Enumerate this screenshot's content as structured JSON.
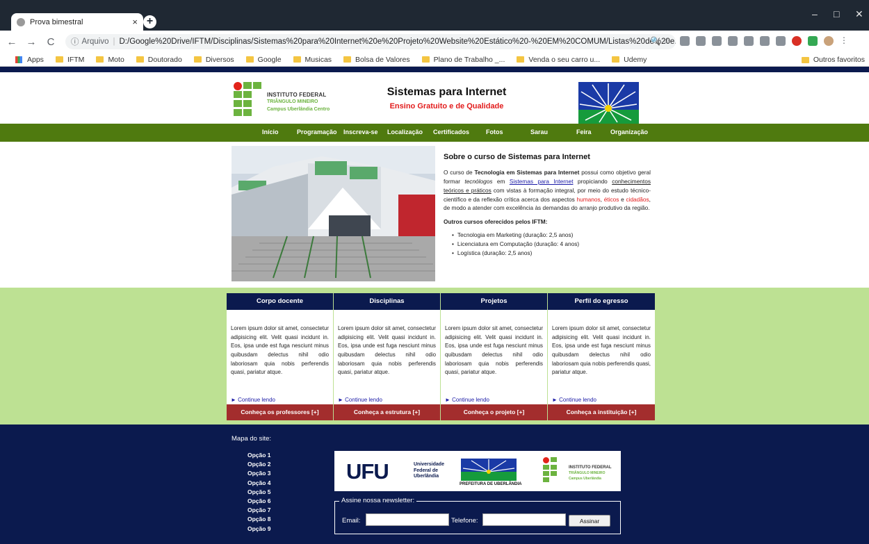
{
  "browser": {
    "tab_title": "Prova bimestral",
    "tab_close": "×",
    "new_tab": "+",
    "nav": {
      "back": "←",
      "forward": "→",
      "reload": "C"
    },
    "address": {
      "info_icon": "ⓘ",
      "scheme": "Arquivo",
      "url": "D:/Google%20Drive/IFTM/Disciplinas/Sistemas%20para%20Internet%20e%20Projeto%20Website%20Estático%20-%20EM%20COMUM/Listas%20de%20e...",
      "zoom_icon": "🔍",
      "star_icon": "☆"
    },
    "window_controls": {
      "minimize": "–",
      "maximize": "□",
      "close": "✕"
    },
    "bookmarks": [
      "Apps",
      "IFTM",
      "Moto",
      "Doutorado",
      "Diversos",
      "Google",
      "Musicas",
      "Bolsa de Valores",
      "Plano de Trabalho _...",
      "Venda o seu carro u...",
      "Udemy"
    ],
    "bookmarks_right": "Outros favoritos"
  },
  "header": {
    "logo_line1": "INSTITUTO FEDERAL",
    "logo_line2": "TRIÂNGULO MINEIRO",
    "logo_line3": "Campus Uberlândia Centro",
    "title": "Sistemas para Internet",
    "subtitle": "Ensino Gratuito e de Qualidade"
  },
  "nav": [
    "Início",
    "Programação",
    "Inscreva-se",
    "Localização",
    "Certificados",
    "Fotos",
    "Sarau",
    "Feira",
    "Organização"
  ],
  "about": {
    "heading": "Sobre o curso de Sistemas para Internet",
    "p_part1": "O curso de ",
    "p_bold": "Tecnologia em Sistemas para Internet",
    "p_part2": " possui como objetivo geral formar ",
    "p_italic": "tecnólogos",
    "p_part3": " em ",
    "p_link": "Sistemas para Internet",
    "p_part4": " propiciando ",
    "p_underline": "conhecimentos teóricos e práticos",
    "p_part5": " com vistas à formação integral, por meio do estudo técnico-científico e da reflexão crítica acerca dos aspectos ",
    "p_red1": "humanos",
    "p_comma": ", ",
    "p_red2": "éticos",
    "p_e": " e ",
    "p_red3": "cidadãos",
    "p_part6": ", de modo a atender com excelência às demandas do arranjo produtivo da região.",
    "other_heading": "Outros cursos oferecidos pelos IFTM:",
    "courses": [
      "Tecnologia em Marketing (duração: 2,5 anos)",
      "Licenciatura em Computação (duração: 4 anos)",
      "Logística (duração: 2,5 anos)"
    ]
  },
  "cards": [
    {
      "title": "Corpo docente",
      "text": "Lorem ipsum dolor sit amet, consectetur adipisicing elit. Velit quasi incidunt in. Eos, ipsa unde est fuga nesciunt minus quibusdam delectus nihil odio laboriosam quia nobis perferendis quasi, pariatur atque.",
      "more": "► Continue lendo",
      "foot": "Conheça os professores [+]"
    },
    {
      "title": "Disciplinas",
      "text": "Lorem ipsum dolor sit amet, consectetur adipisicing elit. Velit quasi incidunt in. Eos, ipsa unde est fuga nesciunt minus quibusdam delectus nihil odio laboriosam quia nobis perferendis quasi, pariatur atque.",
      "more": "► Continue lendo",
      "foot": "Conheça a estrutura [+]"
    },
    {
      "title": "Projetos",
      "text": "Lorem ipsum dolor sit amet, consectetur adipisicing elit. Velit quasi incidunt in. Eos, ipsa unde est fuga nesciunt minus quibusdam delectus nihil odio laboriosam quia nobis perferendis quasi, pariatur atque.",
      "more": "► Continue lendo",
      "foot": "Conheça o projeto [+]"
    },
    {
      "title": "Perfil do egresso",
      "text": "Lorem ipsum dolor sit amet, consectetur adipisicing elit. Velit quasi incidunt in. Eos, ipsa unde est fuga nesciunt minus quibusdam delectus nihil odio laboriosam quia nobis perferendis quasi, pariatur atque.",
      "more": "► Continue lendo",
      "foot": "Conheça a instituição [+]"
    }
  ],
  "footer": {
    "map_title": "Mapa do site:",
    "map_items": [
      "Opção 1",
      "Opção 2",
      "Opção 3",
      "Opção 4",
      "Opção 5",
      "Opção 6",
      "Opção 7",
      "Opção 8",
      "Opção 9"
    ],
    "ufu_big": "UFU",
    "ufu_small1": "Universidade",
    "ufu_small2": "Federal de",
    "ufu_small3": "Uberlândia",
    "pmu": "PREFEITURA DE UBERLÂNDIA",
    "ifes_t1": "INSTITUTO FEDERAL",
    "ifes_t2": "TRIÂNGULO MINEIRO",
    "ifes_t3": "Campus Uberlândia",
    "newsletter_legend": "Assine nossa newsletter:",
    "email_label": "Email:",
    "phone_label": "Telefone:",
    "submit": "Assinar"
  },
  "colors": {
    "dark_navy": "#0b1a4e",
    "nav_green": "#4f7a0f",
    "band_green": "#bde193",
    "card_red": "#a32d2d",
    "brand_green": "#6cb33f",
    "brand_red": "#e2231a"
  }
}
